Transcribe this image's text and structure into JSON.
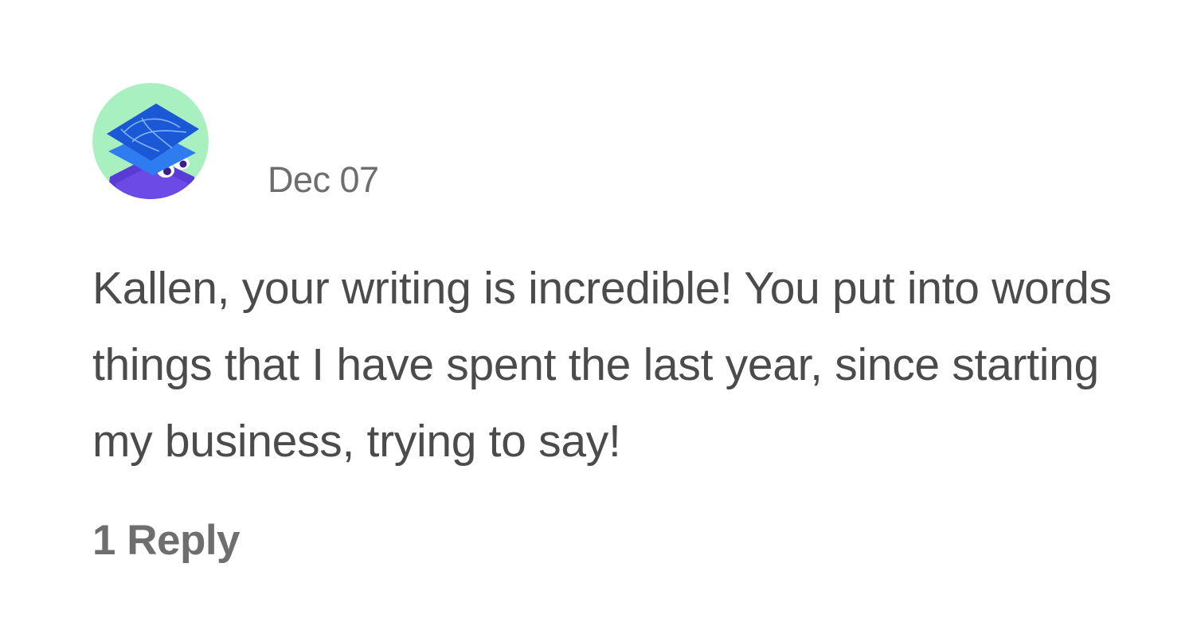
{
  "comment": {
    "avatar_icon": "layered-tiles-creature-icon",
    "date": "Dec 07",
    "text": "Kallen, your writing is incredible! You put into words things that I have spent the last year, since starting my business, trying to say!",
    "reply_label": "1 Reply"
  },
  "colors": {
    "avatar_background": "#a8f0bf",
    "avatar_tile_top": "#1b58d6",
    "avatar_tile_mid": "#2f7bf0",
    "avatar_tile_bottom": "#5a3bd6",
    "text_primary": "#4b4b4b",
    "text_secondary": "#6e6e6e"
  }
}
